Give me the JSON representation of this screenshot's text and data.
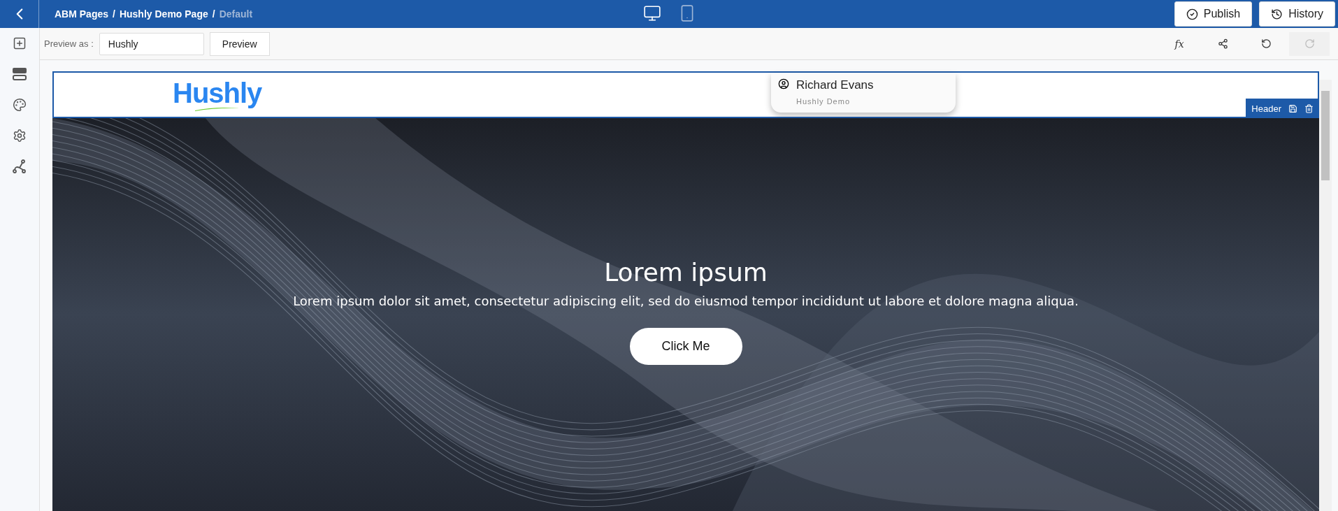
{
  "breadcrumb": [
    {
      "label": "ABM Pages",
      "current": false
    },
    {
      "label": "Hushly Demo Page",
      "current": false
    },
    {
      "label": "Default",
      "current": true
    }
  ],
  "breadcrumb_separators": [
    "/",
    "/"
  ],
  "devices": [
    {
      "kind": "desktop",
      "selected": true
    },
    {
      "kind": "mobile",
      "selected": false
    }
  ],
  "actions": [
    {
      "kind": "publish",
      "label": "Publish"
    },
    {
      "kind": "history",
      "label": "History"
    }
  ],
  "sidebar": {
    "items": [
      {
        "kind": "add"
      },
      {
        "kind": "sections"
      },
      {
        "kind": "palette"
      },
      {
        "kind": "settings"
      },
      {
        "kind": "flow"
      }
    ]
  },
  "toolbar": {
    "preview_label": "Preview as :",
    "preview_value": "Hushly",
    "preview_button": "Preview",
    "tools": [
      {
        "kind": "function",
        "label": "fx",
        "disabled": false
      },
      {
        "kind": "share",
        "disabled": false
      },
      {
        "kind": "undo",
        "disabled": false
      },
      {
        "kind": "redo",
        "disabled": true
      }
    ]
  },
  "page_header": {
    "logo": "Hushly",
    "visitor": {
      "name": "Richard Evans",
      "company": "Hushly Demo"
    },
    "section_tag": "Header"
  },
  "hero": {
    "kind": "picture",
    "title": "Lorem ipsum",
    "text": "Lorem ipsum dolor sit amet, consectetur adipiscing elit, sed do eiusmod tempor incididunt ut labore et dolore magna aliqua.",
    "button": "Click Me"
  }
}
